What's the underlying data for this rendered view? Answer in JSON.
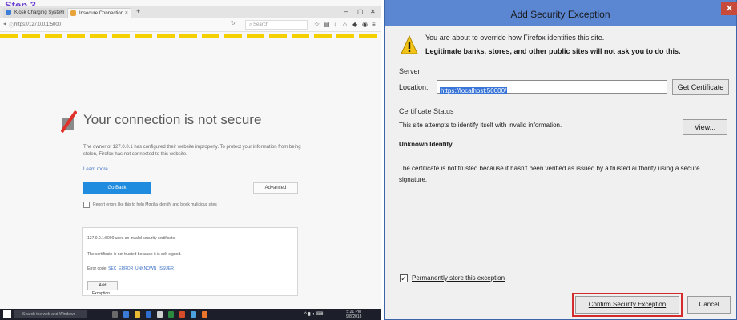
{
  "step_label": "Step 3",
  "browser": {
    "tabs": [
      {
        "label": "Kiosk Charging System"
      },
      {
        "label": "Insecure Connection"
      }
    ],
    "new_tab": "+",
    "window_controls": [
      "–",
      "▢",
      "✕"
    ],
    "url": "https://127.0.0.1:5000",
    "search_placeholder": "Search",
    "page_title": "Your connection is not secure",
    "description": "The owner of 127.0.0.1 has configured their website improperly. To protect your information from being stolen, Firefox has not connected to this website.",
    "learn_more": "Learn more...",
    "go_back": "Go Back",
    "advanced": "Advanced",
    "report_text": "Report errors like this to help Mozilla identify and block malicious sites",
    "advanced_panel": {
      "line1": "127.0.0.1:5000 uses an invalid security certificate.",
      "line2": "The certificate is not trusted because it is self-signed.",
      "line3_prefix": "Error code: ",
      "error_code": "SEC_ERROR_UNKNOWN_ISSUER",
      "add_exception": "Add Exception..."
    },
    "taskbar": {
      "search_placeholder": "Search the web and Windows",
      "time": "5:21 PM",
      "date": "9/8/2018"
    }
  },
  "dialog": {
    "title": "Add Security Exception",
    "close": "✕",
    "warning_line1": "You are about to override how Firefox identifies this site.",
    "warning_line2": "Legitimate banks, stores, and other public sites will not ask you to do this.",
    "server_heading": "Server",
    "location_label": "Location:",
    "location_value": "https://localhost:50000/",
    "get_certificate": "Get Certificate",
    "certificate_status_heading": "Certificate Status",
    "status_text": "This site attempts to identify itself with invalid information.",
    "view_button": "View...",
    "unknown_identity": "Unknown Identity",
    "untrusted_text": "The certificate is not trusted because it hasn't been verified as issued by a trusted authority using a secure signature.",
    "permanent_label": "Permanently store this exception",
    "permanent_checked": "✓",
    "confirm_button": "Confirm Security Exception",
    "cancel_button": "Cancel"
  },
  "colors": {
    "accent_blue": "#1f8ce0",
    "warning_stripe": "#f5d000",
    "highlight_red": "#d42c2c",
    "dialog_titlebar": "#5a86d2"
  }
}
